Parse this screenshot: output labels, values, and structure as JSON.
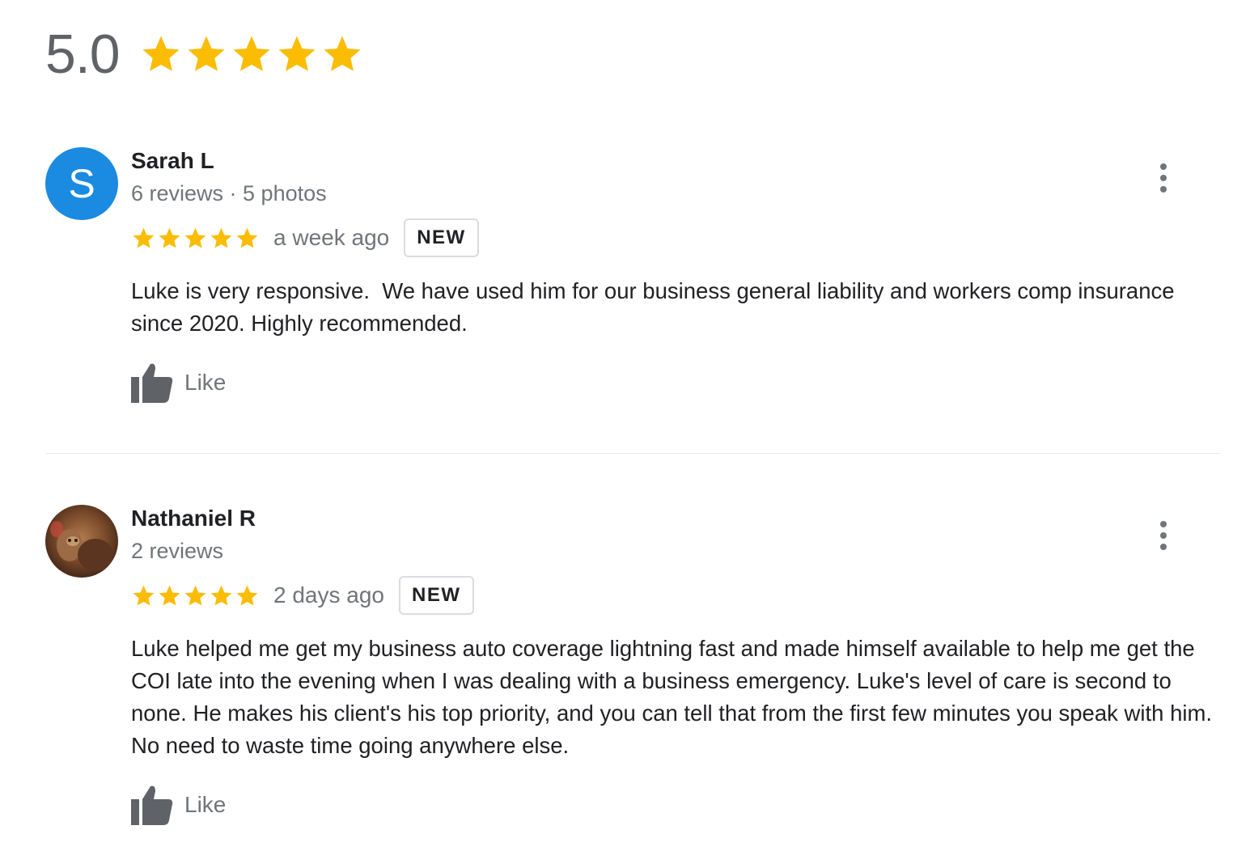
{
  "summary": {
    "rating": "5.0",
    "stars": 5
  },
  "colors": {
    "star": "#fbbc04",
    "accent_avatar": "#1a8be0"
  },
  "reviews": [
    {
      "avatar_letter": "S",
      "name": "Sarah L",
      "meta": "6 reviews · 5 photos",
      "stars": 5,
      "date": "a week ago",
      "badge": "NEW",
      "text": "Luke is very responsive.  We have used him for our business general liability and workers comp insurance since 2020. Highly recommended.",
      "like_label": "Like"
    },
    {
      "avatar_letter": "",
      "name": "Nathaniel R",
      "meta": "2 reviews",
      "stars": 5,
      "date": "2 days ago",
      "badge": "NEW",
      "text": "Luke helped me get my business auto coverage lightning fast and made himself available to help me get the COI late into the evening when I was dealing with a business emergency. Luke's level of care is second to none. He makes his client's his top priority, and you can tell that from the first few minutes you speak with him. No need to waste time going anywhere else.",
      "like_label": "Like"
    }
  ],
  "icons": {
    "star": "star-icon",
    "like": "thumbs-up-icon",
    "more": "more-vertical-icon",
    "avatar_photo": "user-photo-avatar"
  }
}
